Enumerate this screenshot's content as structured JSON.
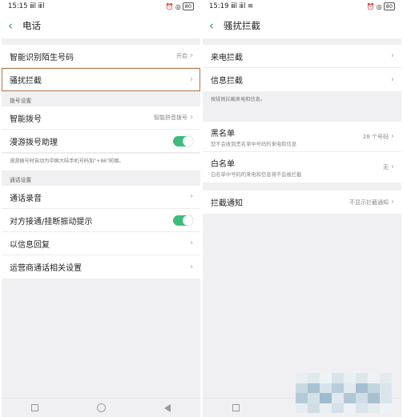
{
  "left": {
    "status": {
      "time": "15:15",
      "signal": "ⅲl ⅲl",
      "battery": "80"
    },
    "title": "电话",
    "items1": [
      {
        "label": "智能识别陌生号码",
        "value": "开启"
      },
      {
        "label": "骚扰拦截",
        "value": ""
      }
    ],
    "section_dial": "拨号设置",
    "smart_dial": {
      "label": "智能拨号",
      "value": "智能拼音拨号"
    },
    "roaming": {
      "label": "漫游拨号助理",
      "toggle": "on"
    },
    "roaming_note": "漫游拨号时自动为中国大陆手机号码加\"+86\"前缀。",
    "section_call": "通话设置",
    "items3": [
      {
        "label": "通话录音"
      },
      {
        "label": "对方接通/挂断振动提示",
        "toggle": "on"
      },
      {
        "label": "以信息回复"
      },
      {
        "label": "运营商通话相关设置"
      }
    ]
  },
  "right": {
    "status": {
      "time": "15:19",
      "signal": "ⅲl ⅲl",
      "battery": "80"
    },
    "title": "骚扰拦截",
    "items1": [
      {
        "label": "来电拦截"
      },
      {
        "label": "信息拦截"
      }
    ],
    "note": "按规则拦截来电和信息。",
    "blacklist": {
      "label": "黑名单",
      "sub": "您不会收到黑名单中号码的来电和信息",
      "value": "28 个号码"
    },
    "whitelist": {
      "label": "白名单",
      "sub": "白名单中号码的来电和信息将不会被拦截",
      "value": "无"
    },
    "notify": {
      "label": "拦截通知",
      "value": "不显示拦截通知"
    }
  },
  "colors": {
    "accent": "#2a9a67",
    "toggle_on": "#3dbd7c",
    "highlight_border": "#b0764e"
  },
  "icons": [
    "back-icon",
    "chevron-right-icon",
    "alarm-icon",
    "wifi-icon",
    "battery-icon",
    "nav-recent-icon",
    "nav-home-icon",
    "nav-back-icon"
  ]
}
